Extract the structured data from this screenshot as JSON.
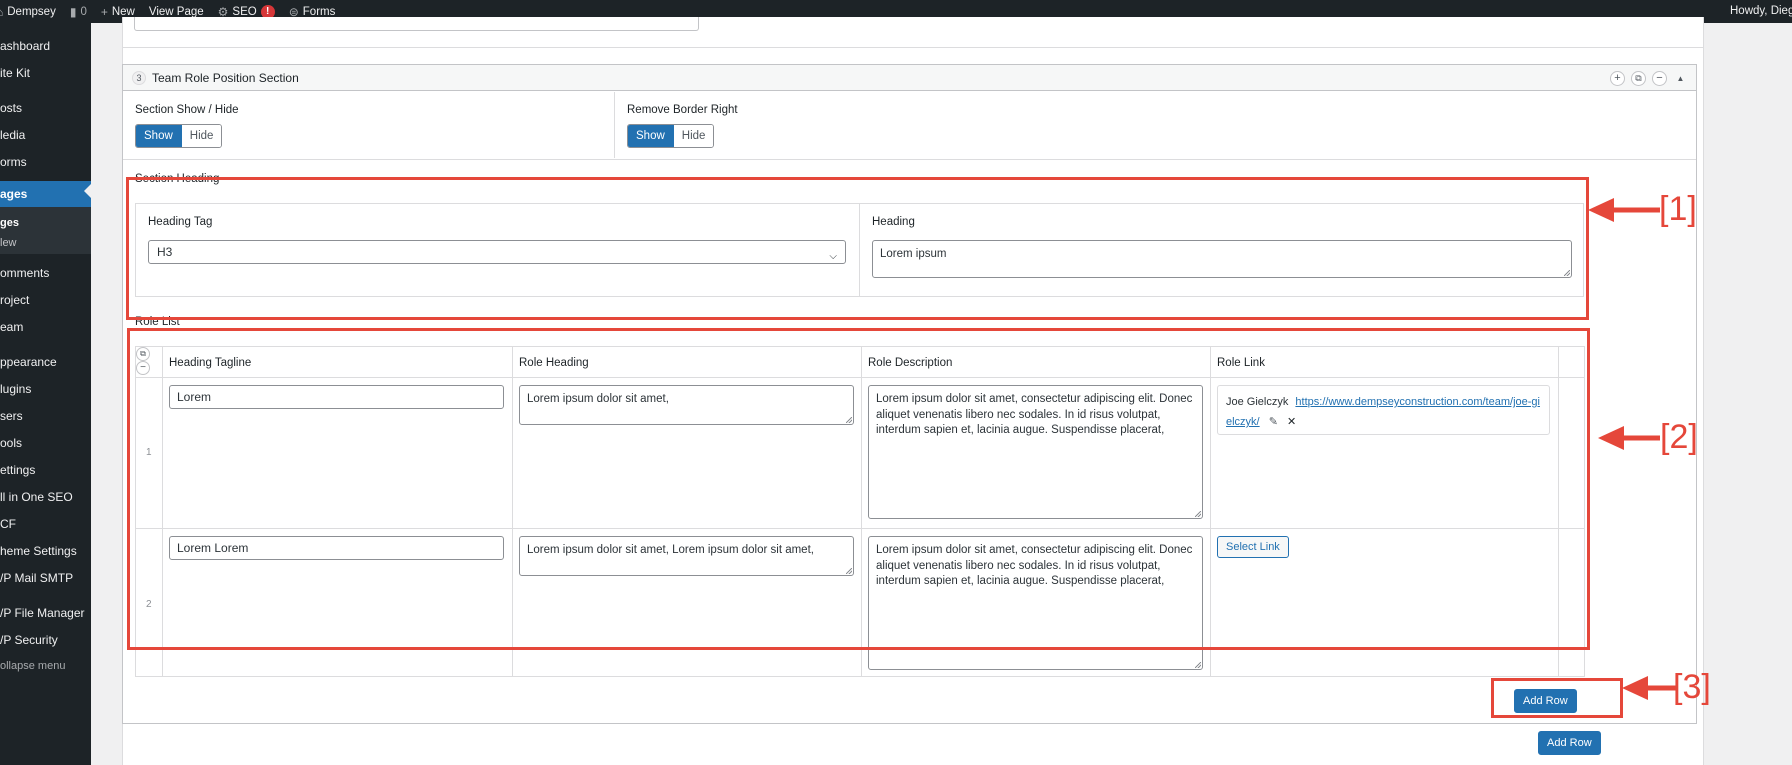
{
  "adminbar": {
    "site_name": "Dempsey",
    "comments_count": "0",
    "new_label": "New",
    "view_page_label": "View Page",
    "seo_label": "SEO",
    "seo_badge": "!",
    "forms_label": "Forms",
    "howdy": "Howdy, Dieg"
  },
  "sidebar": {
    "items": [
      {
        "label": "ashboard"
      },
      {
        "label": "ite Kit"
      },
      {
        "label": "osts"
      },
      {
        "label": "ledia"
      },
      {
        "label": "orms"
      },
      {
        "label": "ages"
      },
      {
        "label": "ges"
      },
      {
        "label": "lew"
      },
      {
        "label": "omments"
      },
      {
        "label": "roject"
      },
      {
        "label": "eam"
      },
      {
        "label": "ppearance"
      },
      {
        "label": "lugins"
      },
      {
        "label": "sers"
      },
      {
        "label": "ools"
      },
      {
        "label": "ettings"
      },
      {
        "label": "ll in One SEO"
      },
      {
        "label": "CF"
      },
      {
        "label": "heme Settings"
      },
      {
        "label": "/P Mail SMTP"
      },
      {
        "label": "/P File Manager"
      },
      {
        "label": "/P Security"
      },
      {
        "label": "ollapse menu"
      }
    ]
  },
  "layout": {
    "order": "3",
    "title": "Team Role Position Section",
    "section_show_hide": {
      "label": "Section Show / Hide",
      "show": "Show",
      "hide": "Hide"
    },
    "remove_border_right": {
      "label": "Remove Border Right",
      "show": "Show",
      "hide": "Hide"
    },
    "section_heading": {
      "label": "Section Heading",
      "heading_tag_label": "Heading Tag",
      "heading_tag_value": "H3",
      "heading_label": "Heading",
      "heading_value": "Lorem ipsum"
    },
    "role_list": {
      "label": "Role List",
      "columns": [
        "Heading Tagline",
        "Role Heading",
        "Role Description",
        "Role Link"
      ],
      "rows": [
        {
          "num": "1",
          "tagline": "Lorem",
          "heading": "Lorem ipsum dolor sit amet,",
          "description": "Lorem ipsum dolor sit amet, consectetur adipiscing elit. Donec aliquet venenatis libero nec sodales. In id risus volutpat, interdum sapien et, lacinia augue. Suspendisse placerat,",
          "link_title": "Joe Gielczyk",
          "link_url": "https://www.dempseyconstruction.com/team/joe-gielczyk/"
        },
        {
          "num": "2",
          "tagline": "Lorem Lorem",
          "heading": "Lorem ipsum dolor sit amet, Lorem ipsum dolor sit amet,",
          "description": "Lorem ipsum dolor sit amet, consectetur adipiscing elit. Donec aliquet venenatis libero nec sodales. In id risus volutpat, interdum sapien et, lacinia augue. Suspendisse placerat,",
          "select_link": "Select Link"
        }
      ],
      "add_row": "Add Row"
    }
  },
  "outer_add_row": "Add Row",
  "annotations": [
    "[1]",
    "[2]",
    "[3]"
  ],
  "colors": {
    "annotation": "#e5473a",
    "primary": "#2271b1",
    "adminbar": "#1d2327"
  }
}
